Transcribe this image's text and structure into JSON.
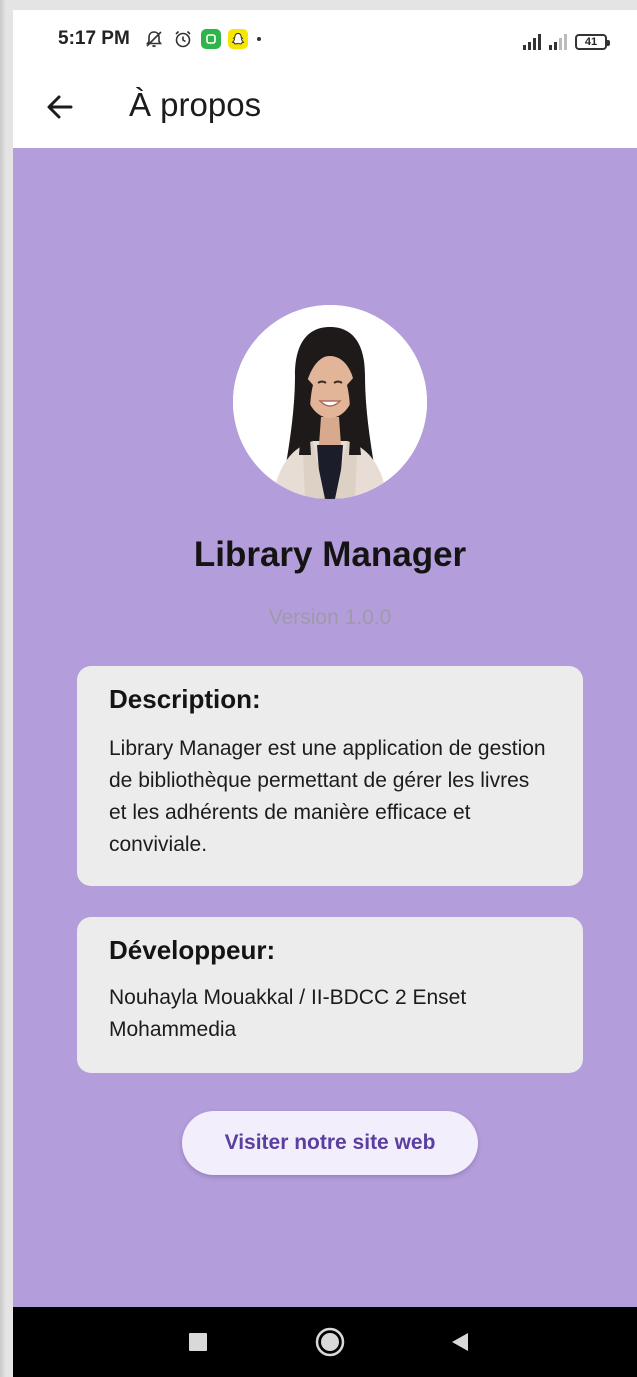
{
  "status_bar": {
    "time": "5:17 PM",
    "battery": "41",
    "icons_left": [
      "muted-bell-icon",
      "alarm-icon",
      "app-notification-icon",
      "snapchat-icon",
      "dot-icon"
    ],
    "icons_right": [
      "signal-icon",
      "signal-weak-icon",
      "battery-icon"
    ]
  },
  "app_bar": {
    "title": "À propos",
    "back_icon": "arrow-left-icon"
  },
  "about": {
    "app_name": "Library Manager",
    "version": "Version 1.0.0",
    "avatar": "developer-photo"
  },
  "description_card": {
    "title": "Description:",
    "body": "Library Manager est une application de gestion de bibliothèque permettant de gérer les livres et les adhérents de manière efficace et conviviale."
  },
  "developer_card": {
    "title": "Développeur:",
    "body": "Nouhayla Mouakkal / II-BDCC 2 Enset Mohammedia"
  },
  "website_button": {
    "label": "Visiter notre site web"
  },
  "nav_bar": {
    "icons": [
      "recents-square-icon",
      "home-circle-icon",
      "back-triangle-icon"
    ]
  },
  "colors": {
    "background": "#b39ddb",
    "card": "#ececec",
    "button_text": "#5b3fa0",
    "version_text": "#9e9aa8"
  }
}
